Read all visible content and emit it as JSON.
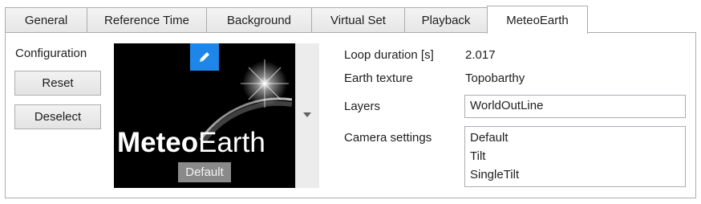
{
  "tabs": [
    {
      "label": "General"
    },
    {
      "label": "Reference Time"
    },
    {
      "label": "Background"
    },
    {
      "label": "Virtual Set"
    },
    {
      "label": "Playback"
    },
    {
      "label": "MeteoEarth",
      "active": true
    }
  ],
  "configuration": {
    "label": "Configuration",
    "reset_label": "Reset",
    "deselect_label": "Deselect",
    "preview": {
      "logo_bold": "Meteo",
      "logo_regular": "Earth",
      "preset_name": "Default"
    }
  },
  "properties": {
    "loop_duration_label": "Loop duration [s]",
    "loop_duration_value": "2.017",
    "earth_texture_label": "Earth texture",
    "earth_texture_value": "Topobarthy",
    "layers_label": "Layers",
    "layers_value": "WorldOutLine",
    "camera_settings_label": "Camera settings",
    "camera_settings_items": [
      "Default",
      "Tilt",
      "SingleTilt"
    ]
  },
  "colors": {
    "edit_button": "#1e86e8",
    "preview_background": "#000000",
    "preset_badge": "#8a8a8a"
  }
}
